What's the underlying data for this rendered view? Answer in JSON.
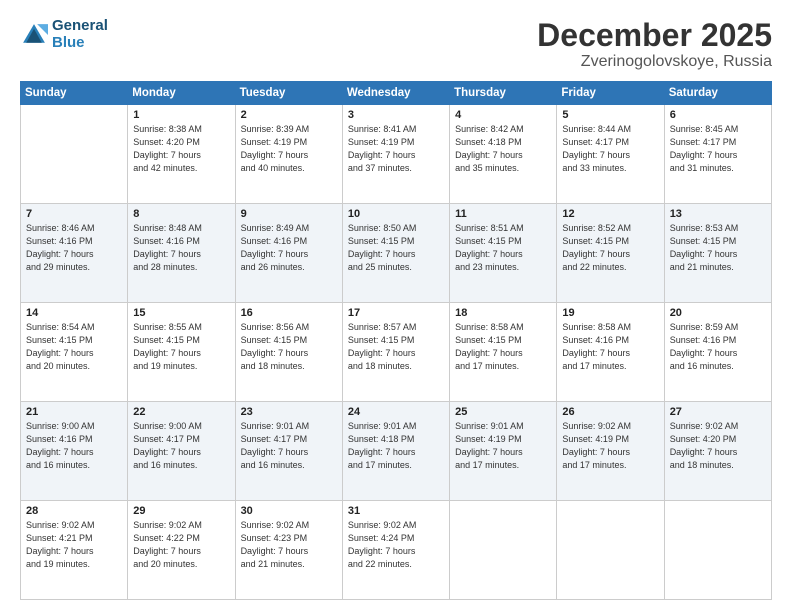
{
  "logo": {
    "line1": "General",
    "line2": "Blue"
  },
  "header": {
    "month": "December 2025",
    "location": "Zverinogolovskoye, Russia"
  },
  "weekdays": [
    "Sunday",
    "Monday",
    "Tuesday",
    "Wednesday",
    "Thursday",
    "Friday",
    "Saturday"
  ],
  "weeks": [
    [
      {
        "day": "",
        "info": ""
      },
      {
        "day": "1",
        "info": "Sunrise: 8:38 AM\nSunset: 4:20 PM\nDaylight: 7 hours\nand 42 minutes."
      },
      {
        "day": "2",
        "info": "Sunrise: 8:39 AM\nSunset: 4:19 PM\nDaylight: 7 hours\nand 40 minutes."
      },
      {
        "day": "3",
        "info": "Sunrise: 8:41 AM\nSunset: 4:19 PM\nDaylight: 7 hours\nand 37 minutes."
      },
      {
        "day": "4",
        "info": "Sunrise: 8:42 AM\nSunset: 4:18 PM\nDaylight: 7 hours\nand 35 minutes."
      },
      {
        "day": "5",
        "info": "Sunrise: 8:44 AM\nSunset: 4:17 PM\nDaylight: 7 hours\nand 33 minutes."
      },
      {
        "day": "6",
        "info": "Sunrise: 8:45 AM\nSunset: 4:17 PM\nDaylight: 7 hours\nand 31 minutes."
      }
    ],
    [
      {
        "day": "7",
        "info": "Sunrise: 8:46 AM\nSunset: 4:16 PM\nDaylight: 7 hours\nand 29 minutes."
      },
      {
        "day": "8",
        "info": "Sunrise: 8:48 AM\nSunset: 4:16 PM\nDaylight: 7 hours\nand 28 minutes."
      },
      {
        "day": "9",
        "info": "Sunrise: 8:49 AM\nSunset: 4:16 PM\nDaylight: 7 hours\nand 26 minutes."
      },
      {
        "day": "10",
        "info": "Sunrise: 8:50 AM\nSunset: 4:15 PM\nDaylight: 7 hours\nand 25 minutes."
      },
      {
        "day": "11",
        "info": "Sunrise: 8:51 AM\nSunset: 4:15 PM\nDaylight: 7 hours\nand 23 minutes."
      },
      {
        "day": "12",
        "info": "Sunrise: 8:52 AM\nSunset: 4:15 PM\nDaylight: 7 hours\nand 22 minutes."
      },
      {
        "day": "13",
        "info": "Sunrise: 8:53 AM\nSunset: 4:15 PM\nDaylight: 7 hours\nand 21 minutes."
      }
    ],
    [
      {
        "day": "14",
        "info": "Sunrise: 8:54 AM\nSunset: 4:15 PM\nDaylight: 7 hours\nand 20 minutes."
      },
      {
        "day": "15",
        "info": "Sunrise: 8:55 AM\nSunset: 4:15 PM\nDaylight: 7 hours\nand 19 minutes."
      },
      {
        "day": "16",
        "info": "Sunrise: 8:56 AM\nSunset: 4:15 PM\nDaylight: 7 hours\nand 18 minutes."
      },
      {
        "day": "17",
        "info": "Sunrise: 8:57 AM\nSunset: 4:15 PM\nDaylight: 7 hours\nand 18 minutes."
      },
      {
        "day": "18",
        "info": "Sunrise: 8:58 AM\nSunset: 4:15 PM\nDaylight: 7 hours\nand 17 minutes."
      },
      {
        "day": "19",
        "info": "Sunrise: 8:58 AM\nSunset: 4:16 PM\nDaylight: 7 hours\nand 17 minutes."
      },
      {
        "day": "20",
        "info": "Sunrise: 8:59 AM\nSunset: 4:16 PM\nDaylight: 7 hours\nand 16 minutes."
      }
    ],
    [
      {
        "day": "21",
        "info": "Sunrise: 9:00 AM\nSunset: 4:16 PM\nDaylight: 7 hours\nand 16 minutes."
      },
      {
        "day": "22",
        "info": "Sunrise: 9:00 AM\nSunset: 4:17 PM\nDaylight: 7 hours\nand 16 minutes."
      },
      {
        "day": "23",
        "info": "Sunrise: 9:01 AM\nSunset: 4:17 PM\nDaylight: 7 hours\nand 16 minutes."
      },
      {
        "day": "24",
        "info": "Sunrise: 9:01 AM\nSunset: 4:18 PM\nDaylight: 7 hours\nand 17 minutes."
      },
      {
        "day": "25",
        "info": "Sunrise: 9:01 AM\nSunset: 4:19 PM\nDaylight: 7 hours\nand 17 minutes."
      },
      {
        "day": "26",
        "info": "Sunrise: 9:02 AM\nSunset: 4:19 PM\nDaylight: 7 hours\nand 17 minutes."
      },
      {
        "day": "27",
        "info": "Sunrise: 9:02 AM\nSunset: 4:20 PM\nDaylight: 7 hours\nand 18 minutes."
      }
    ],
    [
      {
        "day": "28",
        "info": "Sunrise: 9:02 AM\nSunset: 4:21 PM\nDaylight: 7 hours\nand 19 minutes."
      },
      {
        "day": "29",
        "info": "Sunrise: 9:02 AM\nSunset: 4:22 PM\nDaylight: 7 hours\nand 20 minutes."
      },
      {
        "day": "30",
        "info": "Sunrise: 9:02 AM\nSunset: 4:23 PM\nDaylight: 7 hours\nand 21 minutes."
      },
      {
        "day": "31",
        "info": "Sunrise: 9:02 AM\nSunset: 4:24 PM\nDaylight: 7 hours\nand 22 minutes."
      },
      {
        "day": "",
        "info": ""
      },
      {
        "day": "",
        "info": ""
      },
      {
        "day": "",
        "info": ""
      }
    ]
  ]
}
